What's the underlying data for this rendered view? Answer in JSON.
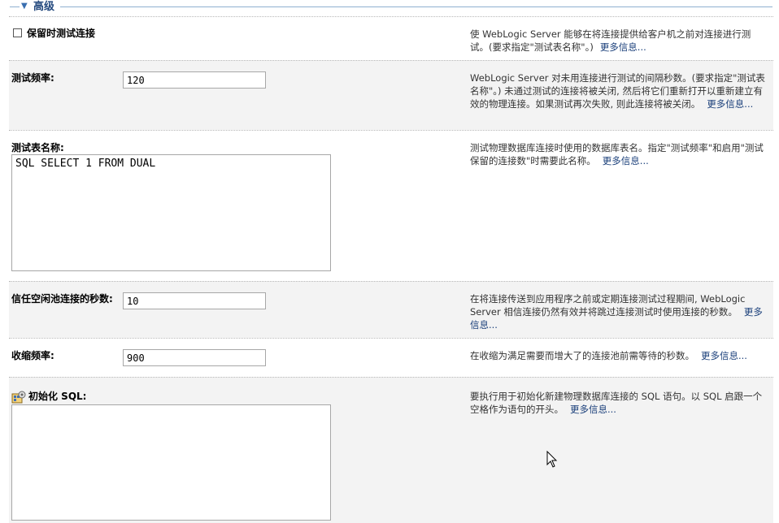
{
  "section": {
    "title": "高级",
    "toggle_icon": "triangle-down-icon"
  },
  "rows": {
    "test_on_reserve": {
      "label": "保留时测试连接",
      "checked": false,
      "desc": "使 WebLogic Server 能够在将连接提供给客户机之前对连接进行测试。(要求指定\"测试表名称\"。)",
      "more": "更多信息..."
    },
    "test_frequency": {
      "label": "测试频率:",
      "value": "120",
      "desc": "WebLogic Server 对未用连接进行测试的间隔秒数。(要求指定\"测试表名称\"。) 未通过测试的连接将被关闭, 然后将它们重新打开以重新建立有效的物理连接。如果测试再次失败, 则此连接将被关闭。",
      "more": "更多信息..."
    },
    "test_table_name": {
      "label": "测试表名称:",
      "value": "SQL SELECT 1 FROM DUAL",
      "desc": "测试物理数据库连接时使用的数据库表名。指定\"测试频率\"和启用\"测试保留的连接数\"时需要此名称。",
      "more": "更多信息..."
    },
    "seconds_to_trust": {
      "label": "信任空闲池连接的秒数:",
      "value": "10",
      "desc": "在将连接传送到应用程序之前或定期连接测试过程期间, WebLogic Server 相信连接仍然有效并将跳过连接测试时使用连接的秒数。",
      "more": "更多信息..."
    },
    "shrink_frequency": {
      "label": "收缩频率:",
      "value": "900",
      "desc": "在收缩为满足需要而增大了的连接池前需等待的秒数。",
      "more": "更多信息..."
    },
    "init_sql": {
      "label": "初始化 SQL:",
      "icon": "sql-config-icon",
      "value": "",
      "desc": "要执行用于初始化新建物理数据库连接的 SQL 语句。以 SQL 启跟一个空格作为语句的开头。",
      "more": "更多信息..."
    }
  }
}
